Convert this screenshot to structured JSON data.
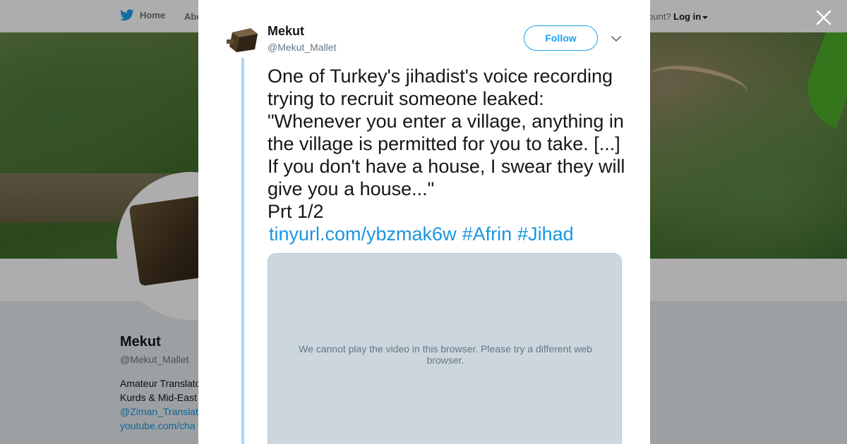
{
  "nav": {
    "home_label": "Home",
    "about_label": "Abo",
    "account_prompt": "ccount?",
    "login_label": "Log in"
  },
  "profile": {
    "name": "Mekut",
    "handle": "@Mekut_Mallet",
    "bio_line1": "Amateur Translato",
    "bio_line2": "Kurds & Mid-East",
    "bio_link": "@Ziman_Translat",
    "bio_youtube": "youtube.com/cha"
  },
  "tweet": {
    "author_name": "Mekut",
    "author_handle": "@Mekut_Mallet",
    "follow_label": "Follow",
    "text": "One of Turkey's jihadist's voice recording trying to recruit someone leaked: \"Whenever you enter a village, anything in the village is permitted for you to take. [...] If you don't have a house, I swear they will give you a house...\"\nPrt 1/2",
    "link_url": "tinyurl.com/ybzmak6w",
    "hashtag_1": "#Afrin",
    "hashtag_2": "#Jihad",
    "video_message": "We cannot play the video in this browser. Please try a different web browser."
  },
  "colors": {
    "twitter_blue": "#1da1f2",
    "link_blue": "#1b95e0",
    "thread_line": "#a4d9f9",
    "video_bg": "#ccd6dd"
  },
  "icons": {
    "brand": "twitter-bird-icon",
    "close": "close-icon",
    "more": "chevron-down-icon"
  }
}
